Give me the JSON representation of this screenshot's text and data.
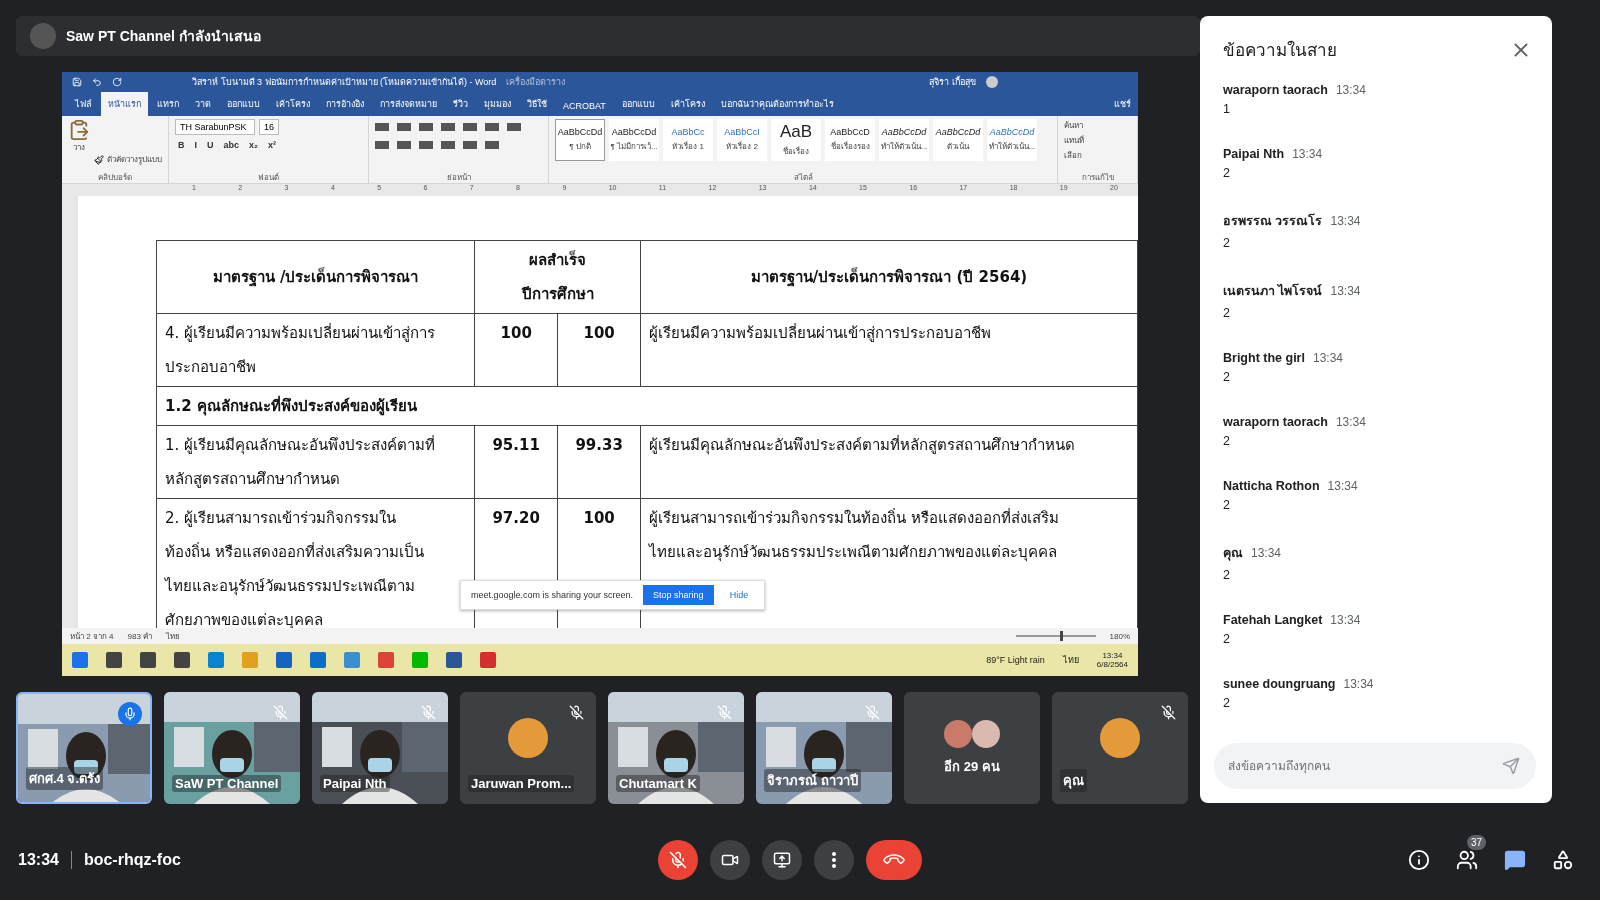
{
  "presenter_bar": {
    "label": "Saw PT Channel กำลังนำเสนอ"
  },
  "word": {
    "title": "วิสราห์ โบนามดี 3 ฟอนัมการกำหนดค่าเป้าหมาย (โหมดความเข้ากันได้) - Word",
    "context_tab": "เครื่องมือตาราง",
    "user": "สุจิรา เกื้อสุข",
    "tabs": [
      {
        "label": "ไฟล์",
        "selected": false
      },
      {
        "label": "หน้าแรก",
        "selected": true
      },
      {
        "label": "แทรก",
        "selected": false
      },
      {
        "label": "วาด",
        "selected": false
      },
      {
        "label": "ออกแบบ",
        "selected": false
      },
      {
        "label": "เค้าโครง",
        "selected": false
      },
      {
        "label": "การอ้างอิง",
        "selected": false
      },
      {
        "label": "การส่งจดหมาย",
        "selected": false
      },
      {
        "label": "รีวิว",
        "selected": false
      },
      {
        "label": "มุมมอง",
        "selected": false
      },
      {
        "label": "วิธีใช้",
        "selected": false
      },
      {
        "label": "ACROBAT",
        "selected": false
      },
      {
        "label": "ออกแบบ",
        "selected": false
      },
      {
        "label": "เค้าโครง",
        "selected": false
      }
    ],
    "tell_me": "บอกฉันว่าคุณต้องการทำอะไร",
    "share": "แชร์",
    "clipboard": {
      "paste": "วาง",
      "format_painter": "ตัวคัดวางรูปแบบ",
      "label": "คลิปบอร์ด"
    },
    "font": {
      "name": "TH SarabunPSK",
      "size": "16",
      "buttons": [
        "B",
        "I",
        "U",
        "abc",
        "x₂",
        "x²"
      ],
      "label": "ฟอนต์"
    },
    "paragraph": {
      "label": "ย่อหน้า"
    },
    "styles": {
      "items": [
        {
          "sample": "AaBbCcDd",
          "name": "¶ ปกติ",
          "selected": true,
          "kind": "normal"
        },
        {
          "sample": "AaBbCcDd",
          "name": "¶ ไม่มีการเว้...",
          "selected": false,
          "kind": "normal"
        },
        {
          "sample": "AaBbCc",
          "name": "หัวเรื่อง 1",
          "selected": false,
          "kind": "heading"
        },
        {
          "sample": "AaBbCcI",
          "name": "หัวเรื่อง 2",
          "selected": false,
          "kind": "heading"
        },
        {
          "sample": "AaB",
          "name": "ชื่อเรื่อง",
          "selected": false,
          "kind": "title"
        },
        {
          "sample": "AaBbCcD",
          "name": "ชื่อเรื่องรอง",
          "selected": false,
          "kind": "subtle"
        },
        {
          "sample": "AaBbCcDd",
          "name": "ทำให้ตัวเน้น...",
          "selected": false,
          "kind": "italic"
        },
        {
          "sample": "AaBbCcDd",
          "name": "ตัวเน้น",
          "selected": false,
          "kind": "italic"
        },
        {
          "sample": "AaBbCcDd",
          "name": "ทำให้ตัวเน้น...",
          "selected": false,
          "kind": "accent"
        }
      ],
      "label": "สไตล์"
    },
    "editing": {
      "items": [
        "ค้นหา",
        "แทนที่",
        "เลือก"
      ],
      "label": "การแก้ไข"
    },
    "ruler": [
      "1",
      "2",
      "3",
      "4",
      "5",
      "6",
      "7",
      "8",
      "9",
      "10",
      "11",
      "12",
      "13",
      "14",
      "15",
      "16",
      "17",
      "18",
      "19",
      "20"
    ],
    "table": {
      "header": {
        "col1": "มาตรฐาน /ประเด็นการพิจารณา",
        "col2": "ผลสำเร็จ\nปีการศึกษา",
        "col3": "มาตรฐาน/ประเด็นการพิจารณา (ปี 2564)"
      },
      "rows": [
        {
          "kind": "item",
          "text": "4. ผู้เรียนมีความพร้อมเปลี่ยนผ่านเข้าสู่การ\nประกอบอาชีพ",
          "a": "100",
          "b": "100",
          "detail": "ผู้เรียนมีความพร้อมเปลี่ยนผ่านเข้าสู่การประกอบอาชีพ"
        },
        {
          "kind": "section",
          "text": "1.2 คุณลักษณะที่พึงประสงค์ของผู้เรียน"
        },
        {
          "kind": "item",
          "text": "1. ผู้เรียนมีคุณลักษณะอันพึงประสงค์ตามที่\nหลักสูตรสถานศึกษากำหนด",
          "a": "95.11",
          "b": "99.33",
          "detail": "ผู้เรียนมีคุณลักษณะอันพึงประสงค์ตามที่หลักสูตรสถานศึกษากำหนด"
        },
        {
          "kind": "item",
          "text": "2. ผู้เรียนสามารถเข้าร่วมกิจกรรมใน\nท้องถิ่น หรือแสดงออกที่ส่งเสริมความเป็น\nไทยและอนุรักษ์วัฒนธรรมประเพณีตาม\nศักยภาพของแต่ละบุคคล",
          "a": "97.20",
          "b": "100",
          "detail": "ผู้เรียนสามารถเข้าร่วมกิจกรรมในท้องถิ่น หรือแสดงออกที่ส่งเสริม\nไทยและอนุรักษ์วัฒนธรรมประเพณีตามศักยภาพของแต่ละบุคคล"
        }
      ]
    },
    "status": {
      "page": "หน้า 2 จาก 4",
      "words": "983 คำ",
      "language": "ไทย",
      "zoom": "180%",
      "level": 0.55
    }
  },
  "share_notice": {
    "text": "meet.google.com is sharing your screen.",
    "stop": "Stop sharing",
    "hide": "Hide"
  },
  "taskbar": {
    "weather": "89°F  Light rain",
    "language": "ไทย",
    "time": "13:34",
    "date": "6/8/2564"
  },
  "tiles": [
    {
      "name": "ศกศ.4 จ.ตรัง",
      "kind": "video",
      "muted": false,
      "speaking": true
    },
    {
      "name": "SaW PT Channel",
      "kind": "video",
      "muted": true,
      "speaking": false
    },
    {
      "name": "Paipai Nth",
      "kind": "video",
      "muted": true,
      "speaking": false
    },
    {
      "name": "Jaruwan Prom...",
      "kind": "avatar",
      "muted": true,
      "speaking": false
    },
    {
      "name": "Chutamart K",
      "kind": "video",
      "muted": true,
      "speaking": false
    },
    {
      "name": "จิราภรณ์ ถาวาปี",
      "kind": "video",
      "muted": true,
      "speaking": false
    },
    {
      "name": "อีก 29 คน",
      "kind": "group",
      "muted": false,
      "speaking": false
    },
    {
      "name": "คุณ",
      "kind": "avatar",
      "muted": true,
      "speaking": false
    }
  ],
  "chat": {
    "title": "ข้อความในสาย",
    "placeholder": "ส่งข้อความถึงทุกคน",
    "messages": [
      {
        "sender": "waraporn taorach",
        "time": "13:34",
        "text": "1"
      },
      {
        "sender": "Paipai Nth",
        "time": "13:34",
        "text": "2"
      },
      {
        "sender": "อรพรรณ วรรณโร",
        "time": "13:34",
        "text": "2"
      },
      {
        "sender": "เนตรนภา ไพโรจน์",
        "time": "13:34",
        "text": "2"
      },
      {
        "sender": "Bright the girl",
        "time": "13:34",
        "text": "2"
      },
      {
        "sender": "waraporn taorach",
        "time": "13:34",
        "text": "2"
      },
      {
        "sender": "Natticha Rothon",
        "time": "13:34",
        "text": "2"
      },
      {
        "sender": "คุณ",
        "time": "13:34",
        "text": "2"
      },
      {
        "sender": "Fatehah Langket",
        "time": "13:34",
        "text": "2"
      },
      {
        "sender": "sunee doungruang",
        "time": "13:34",
        "text": "2"
      }
    ]
  },
  "bottom_bar": {
    "time": "13:34",
    "meeting_code": "boc-rhqz-foc",
    "mic_muted": true,
    "people_count": "37"
  }
}
